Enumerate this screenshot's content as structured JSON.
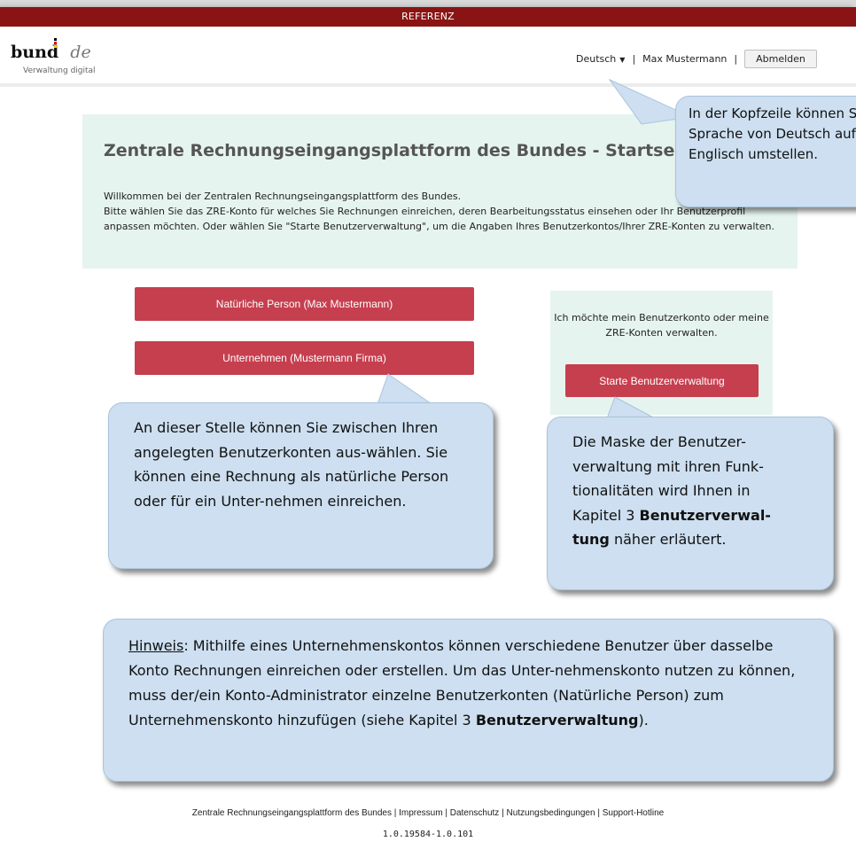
{
  "ref_bar": "REFERENZ",
  "header": {
    "logo_main": "bund",
    "logo_suffix": "de",
    "logo_sub": "Verwaltung digital",
    "language": "Deutsch",
    "separator": "|",
    "user": "Max Mustermann",
    "logout": "Abmelden"
  },
  "welcome": {
    "title": "Zentrale Rechnungseingangsplattform des Bundes - Startseite",
    "line1": "Willkommen bei der Zentralen Rechnungseingangsplattform des Bundes.",
    "line2": "Bitte wählen Sie das ZRE-Konto für welches Sie Rechnungen einreichen, deren Bearbeitungsstatus einsehen oder Ihr Benutzerprofil anpassen möchten. Oder wählen Sie \"Starte Benutzerverwaltung\", um die Angaben Ihres Benutzerkontos/Ihrer ZRE-Konten zu verwalten."
  },
  "accounts": {
    "natural_person": "Natürliche Person (Max Mustermann)",
    "company": "Unternehmen (Mustermann Firma)"
  },
  "admin_box": {
    "text": "Ich möchte mein Benutzerkonto oder meine ZRE-Konten verwalten.",
    "button": "Starte Benutzerverwaltung"
  },
  "callouts": {
    "header_text": "In der Kopfzeile können Sie die Sprache von Deutsch auf Englisch umstellen.",
    "accounts_text": "An dieser Stelle können Sie zwischen Ihren angelegten Benutzerkonten aus-wählen. Sie können eine Rechnung als natürliche Person oder für ein Unter-nehmen einreichen.",
    "admin_text_1": "Die Maske der Benutzer-verwaltung mit ihren Funk-tionalitäten wird Ihnen in Kapitel 3 ",
    "admin_bold": "Benutzerverwal-tung",
    "admin_text_2": " näher erläutert.",
    "note_label": "Hinweis",
    "note_text_1": ": Mithilfe eines Unternehmenskontos können verschiedene Benutzer über dasselbe Konto Rechnungen einreichen oder erstellen. Um das Unter-nehmenskonto nutzen zu können, muss der/ein Konto-Administrator einzelne Benutzerkonten (Natürliche Person) zum Unternehmenskonto hinzufügen (siehe Kapitel 3 ",
    "note_bold": "Benutzerverwaltung",
    "note_text_2": ")."
  },
  "footer": {
    "platform": "Zentrale Rechnungseingangsplattform des Bundes",
    "impressum": "Impressum",
    "datenschutz": "Datenschutz",
    "nutzung": "Nutzungsbedingungen",
    "hotline": "Support-Hotline",
    "separator": " | ",
    "version": "1.0.19584-1.0.101"
  },
  "colors": {
    "ref_bar": "#8a1414",
    "button": "#c63f4f",
    "panel": "#e6f4ef",
    "callout": "#cddff0"
  }
}
